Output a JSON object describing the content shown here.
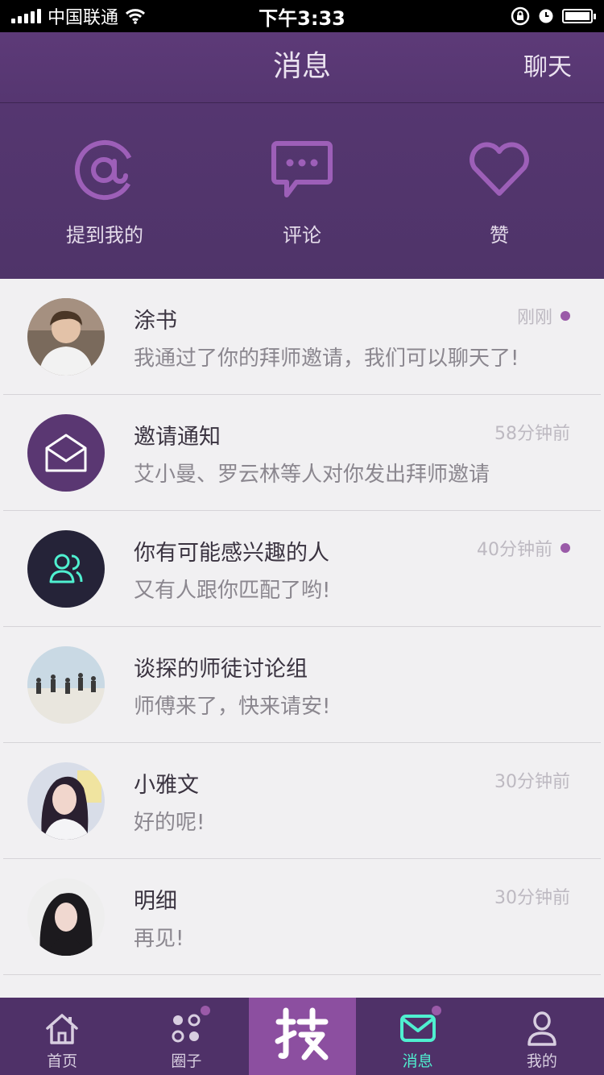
{
  "status_bar": {
    "carrier": "中国联通",
    "time": "下午3:33"
  },
  "nav": {
    "title": "消息",
    "right_action": "聊天"
  },
  "quick_actions": [
    {
      "label": "提到我的",
      "icon": "at-icon"
    },
    {
      "label": "评论",
      "icon": "comment-icon"
    },
    {
      "label": "赞",
      "icon": "heart-icon"
    }
  ],
  "messages": [
    {
      "name": "涂书",
      "preview": "我通过了你的拜师邀请，我们可以聊天了!",
      "time": "刚刚",
      "unread": true,
      "avatar": "photo-boy"
    },
    {
      "name": "邀请通知",
      "preview": "艾小曼、罗云林等人对你发出拜师邀请",
      "time": "58分钟前",
      "unread": false,
      "avatar": "envelope-icon"
    },
    {
      "name": "你有可能感兴趣的人",
      "preview": "又有人跟你匹配了哟!",
      "time": "40分钟前",
      "unread": true,
      "avatar": "people-icon"
    },
    {
      "name": "谈探的师徒讨论组",
      "preview": "师傅来了，快来请安!",
      "time": "",
      "unread": false,
      "avatar": "photo-beach"
    },
    {
      "name": "小雅文",
      "preview": "好的呢!",
      "time": "30分钟前",
      "unread": false,
      "avatar": "photo-girl"
    },
    {
      "name": "明细",
      "preview": "再见!",
      "time": "30分钟前",
      "unread": false,
      "avatar": "photo-woman"
    }
  ],
  "tabs": [
    {
      "label": "首页",
      "icon": "home-icon",
      "active": false,
      "badge": false
    },
    {
      "label": "圈子",
      "icon": "circles-icon",
      "active": false,
      "badge": true
    },
    {
      "label": "",
      "icon": "ji-logo-icon",
      "active": false,
      "badge": false
    },
    {
      "label": "消息",
      "icon": "mail-icon",
      "active": true,
      "badge": true
    },
    {
      "label": "我的",
      "icon": "profile-icon",
      "active": false,
      "badge": false
    }
  ],
  "colors": {
    "header": "#553670",
    "accent": "#9a5aa8",
    "active_tab": "#4ff0d0",
    "center_tab": "#8c4fa0",
    "tab_bar": "#4f3168"
  }
}
